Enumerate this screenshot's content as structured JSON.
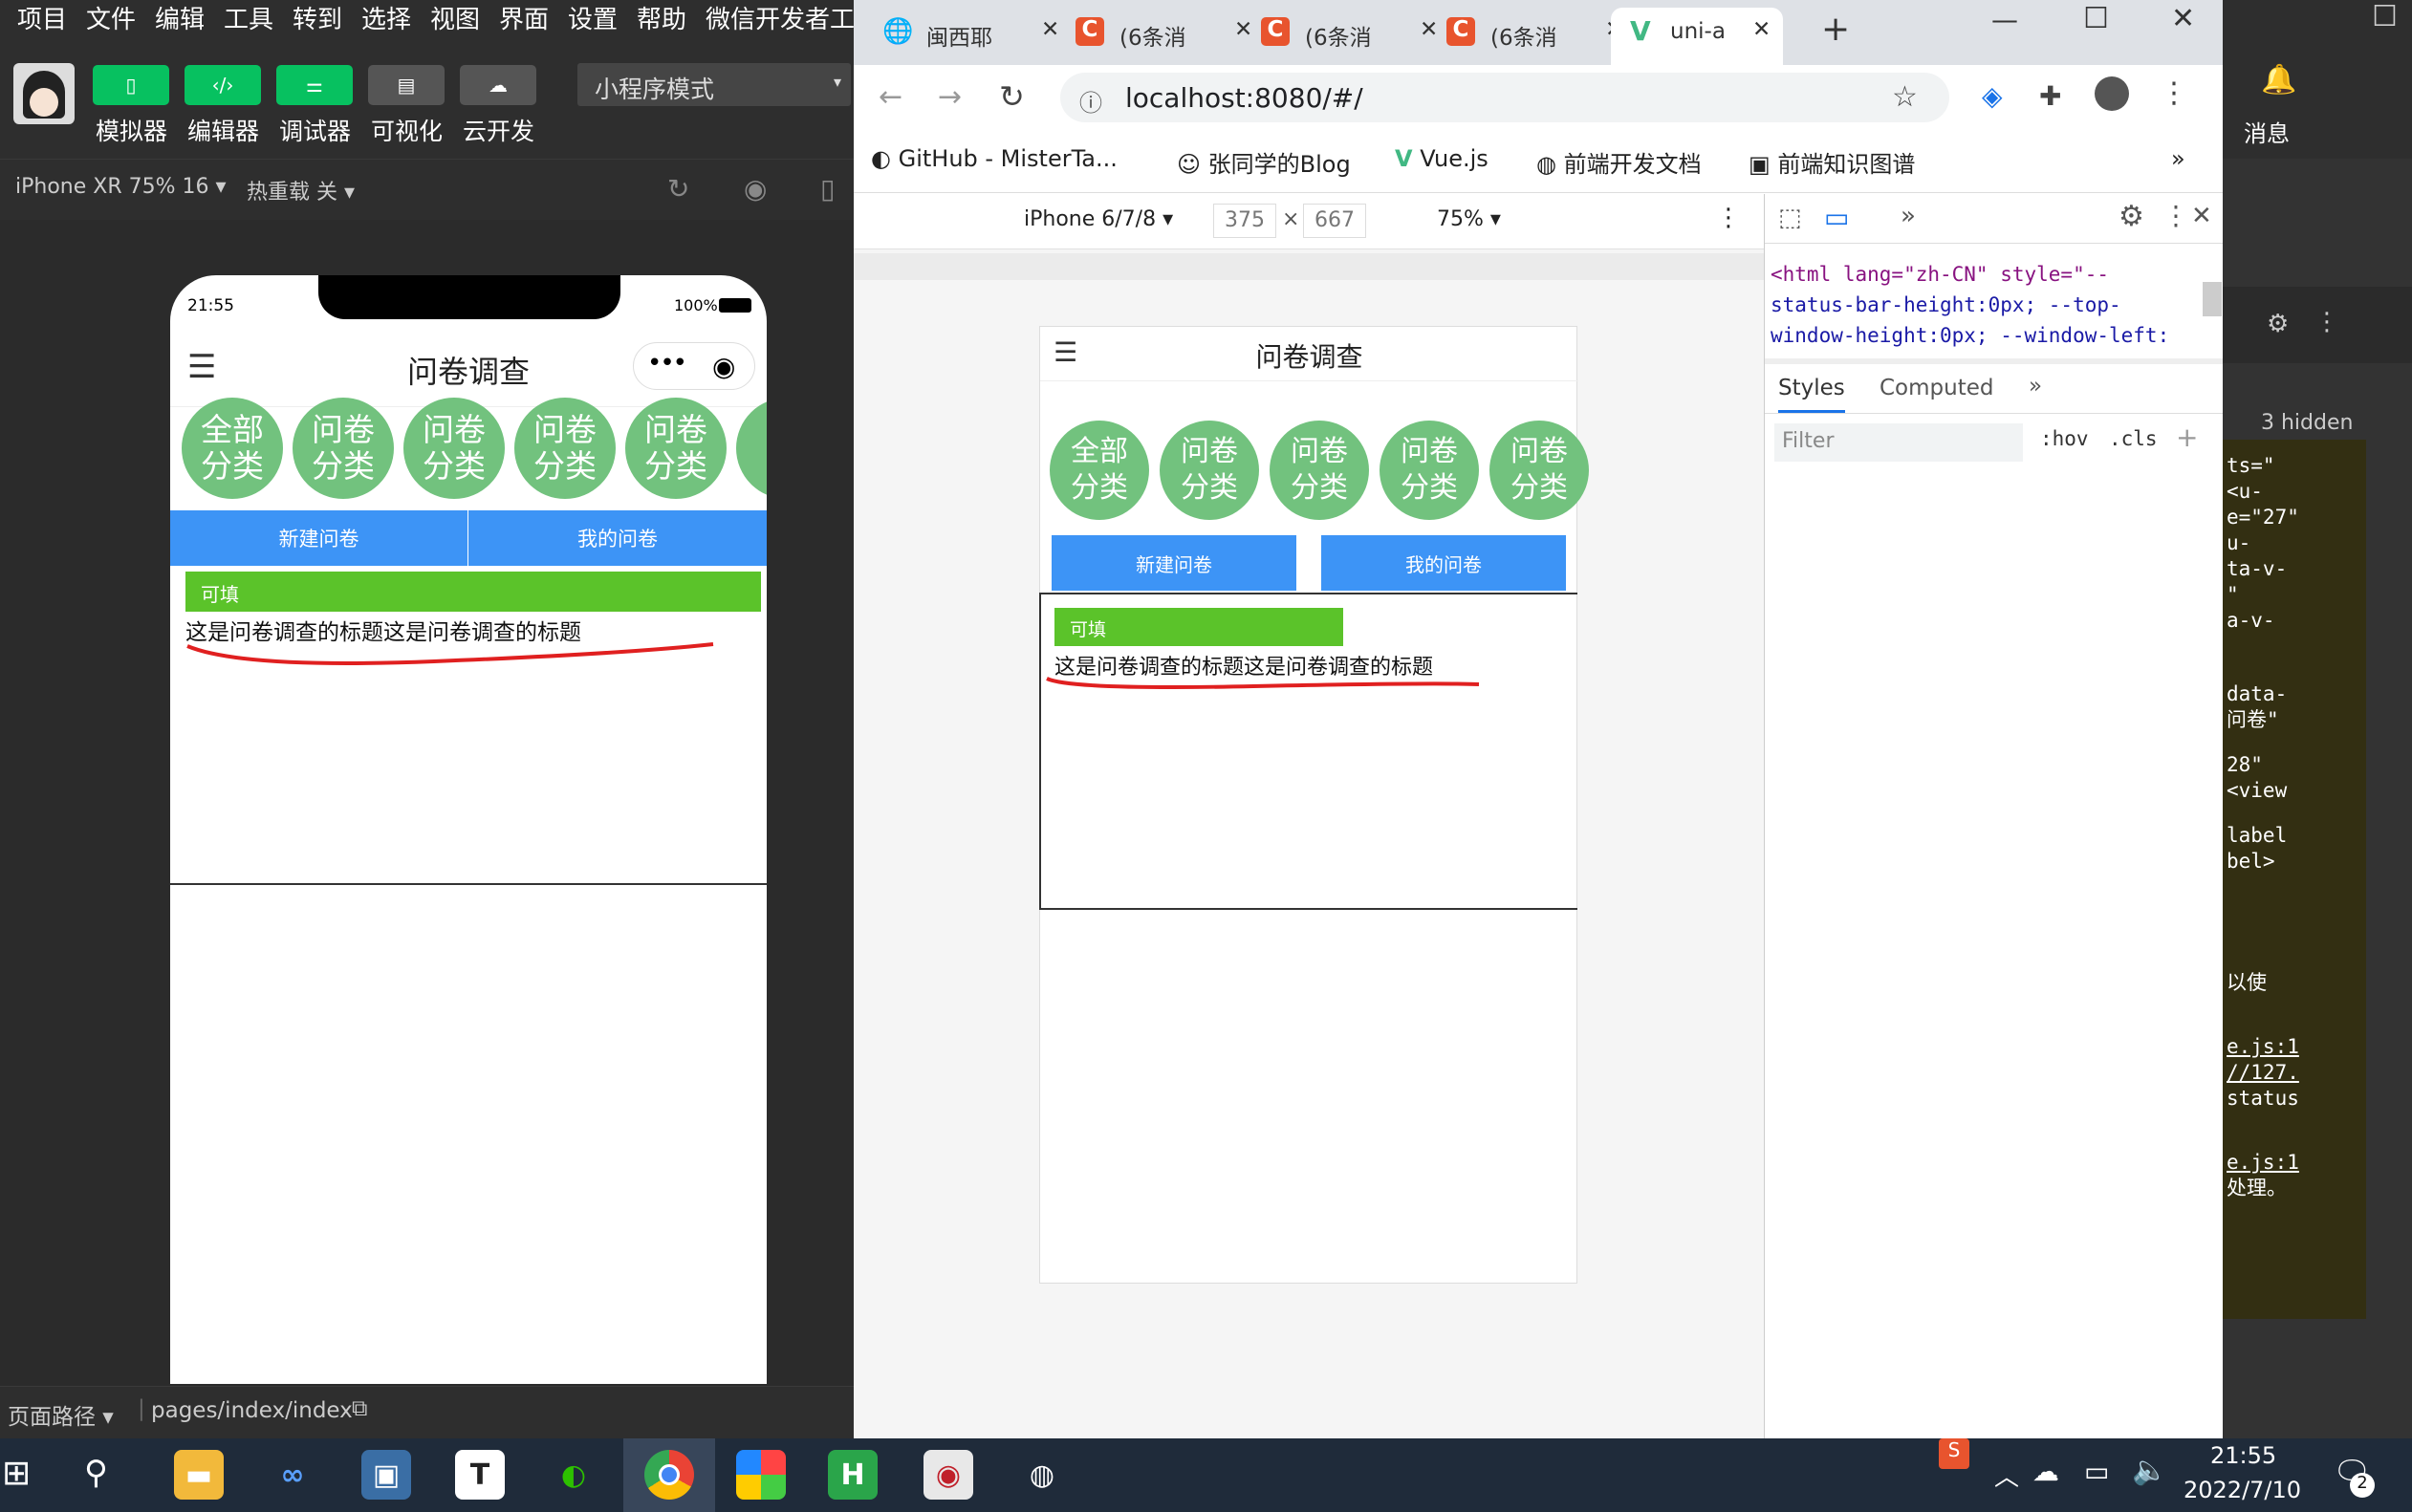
{
  "wx": {
    "menu": [
      "项目",
      "文件",
      "编辑",
      "工具",
      "转到",
      "选择",
      "视图",
      "界面",
      "设置",
      "帮助",
      "微信开发者工"
    ],
    "toolbar": [
      "模拟器",
      "编辑器",
      "调试器",
      "可视化",
      "云开发"
    ],
    "mode": "小程序模式",
    "device": "iPhone XR 75% 16",
    "hot_reload": "热重载 关",
    "path_label": "页面路径",
    "path": "pages/index/index",
    "msg_label": "消息"
  },
  "phone": {
    "time": "21:55",
    "battery": "100%",
    "title": "问卷调查",
    "categories": [
      "全部\n分类",
      "问卷\n分类",
      "问卷\n分类",
      "问卷\n分类",
      "问卷\n分类",
      "问"
    ],
    "btn_new": "新建问卷",
    "btn_mine": "我的问卷",
    "tag": "可填",
    "item_title": "这是问卷调查的标题这是问卷调查的标题"
  },
  "chrome": {
    "tabs": [
      "闽西耶",
      "(6条消",
      "(6条消",
      "(6条消",
      "uni-a"
    ],
    "url": "localhost:8080/#/",
    "bookmarks": [
      "GitHub - MisterTa...",
      "张同学的Blog",
      "Vue.js",
      "前端开发文档",
      "前端知识图谱"
    ],
    "device": "iPhone 6/7/8",
    "width": "375",
    "height": "667",
    "zoom": "75%"
  },
  "emu": {
    "title": "问卷调查",
    "categories": [
      "全部\n分类",
      "问卷\n分类",
      "问卷\n分类",
      "问卷\n分类",
      "问卷\n分类"
    ],
    "btn_new": "新建问卷",
    "btn_mine": "我的问卷",
    "tag": "可填",
    "item_title": "这是问卷调查的标题这是问卷调查的标题"
  },
  "devtools": {
    "html_lines": [
      "<html lang=\"zh-CN\" style=\"--",
      "status-bar-height:0px; --top-",
      "window-height:0px; --window-left:"
    ],
    "tab_styles": "Styles",
    "tab_computed": "Computed",
    "filter": "Filter",
    "hov": ":hov",
    "cls": ".cls",
    "hidden": "3 hidden"
  },
  "rstrip": {
    "code": [
      "ts=\"",
      "<u-",
      "e=\"27\"",
      "u-",
      "ta-v-",
      "\"",
      "a-v-",
      "data-",
      "问卷\"",
      "28\"",
      "<view",
      "label",
      "bel>",
      "以使",
      "e.js:1",
      "//127.",
      "status",
      "e.js:1",
      "处理。"
    ]
  },
  "taskbar": {
    "time": "21:55",
    "date": "2022/7/10",
    "badge": "2"
  }
}
